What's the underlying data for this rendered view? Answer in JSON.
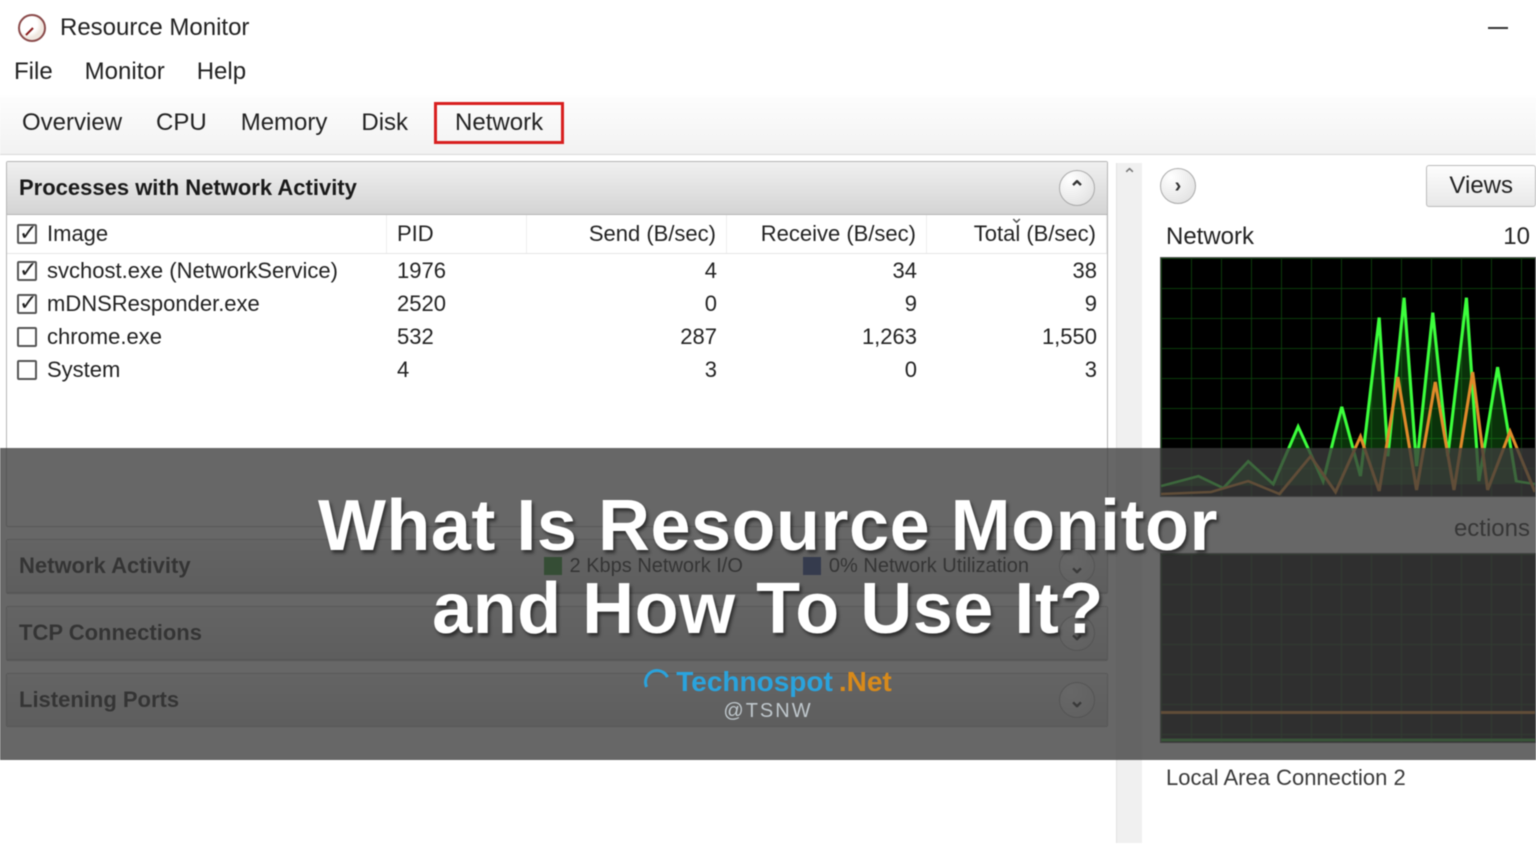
{
  "window": {
    "title": "Resource Monitor"
  },
  "menu": {
    "file": "File",
    "monitor": "Monitor",
    "help": "Help"
  },
  "tabs": {
    "overview": "Overview",
    "cpu": "CPU",
    "memory": "Memory",
    "disk": "Disk",
    "network": "Network"
  },
  "processes_panel": {
    "title": "Processes with Network Activity",
    "columns": {
      "image": "Image",
      "pid": "PID",
      "send": "Send (B/sec)",
      "receive": "Receive (B/sec)",
      "total": "Total (B/sec)"
    },
    "rows": [
      {
        "checked": true,
        "image": "svchost.exe (NetworkService)",
        "pid": "1976",
        "send": "4",
        "receive": "34",
        "total": "38"
      },
      {
        "checked": true,
        "image": "mDNSResponder.exe",
        "pid": "2520",
        "send": "0",
        "receive": "9",
        "total": "9"
      },
      {
        "checked": false,
        "image": "chrome.exe",
        "pid": "532",
        "send": "287",
        "receive": "1,263",
        "total": "1,550"
      },
      {
        "checked": false,
        "image": "System",
        "pid": "4",
        "send": "3",
        "receive": "0",
        "total": "3"
      }
    ]
  },
  "network_activity": {
    "title": "Network Activity",
    "io": "2 Kbps Network I/O",
    "util": "0% Network Utilization"
  },
  "tcp_panel": {
    "title": "TCP Connections"
  },
  "listening_panel": {
    "title": "Listening Ports"
  },
  "right": {
    "views": "Views",
    "chart1": {
      "label": "Network",
      "right": "10"
    },
    "mid_label": "ections",
    "bottom_label": "Local Area Connection 2"
  },
  "overlay": {
    "line1": "What Is Resource Monitor",
    "line2": "and How To Use It?",
    "brand1": "Technospot",
    "brand2": ".Net",
    "sub": "@TSNW"
  },
  "icons": {
    "collapse_up": "⌃",
    "expand_down": "⌄",
    "arrow_right": "›"
  },
  "colors": {
    "swatch_green": "#1f8a1f",
    "swatch_blue": "#1f3a8a"
  }
}
